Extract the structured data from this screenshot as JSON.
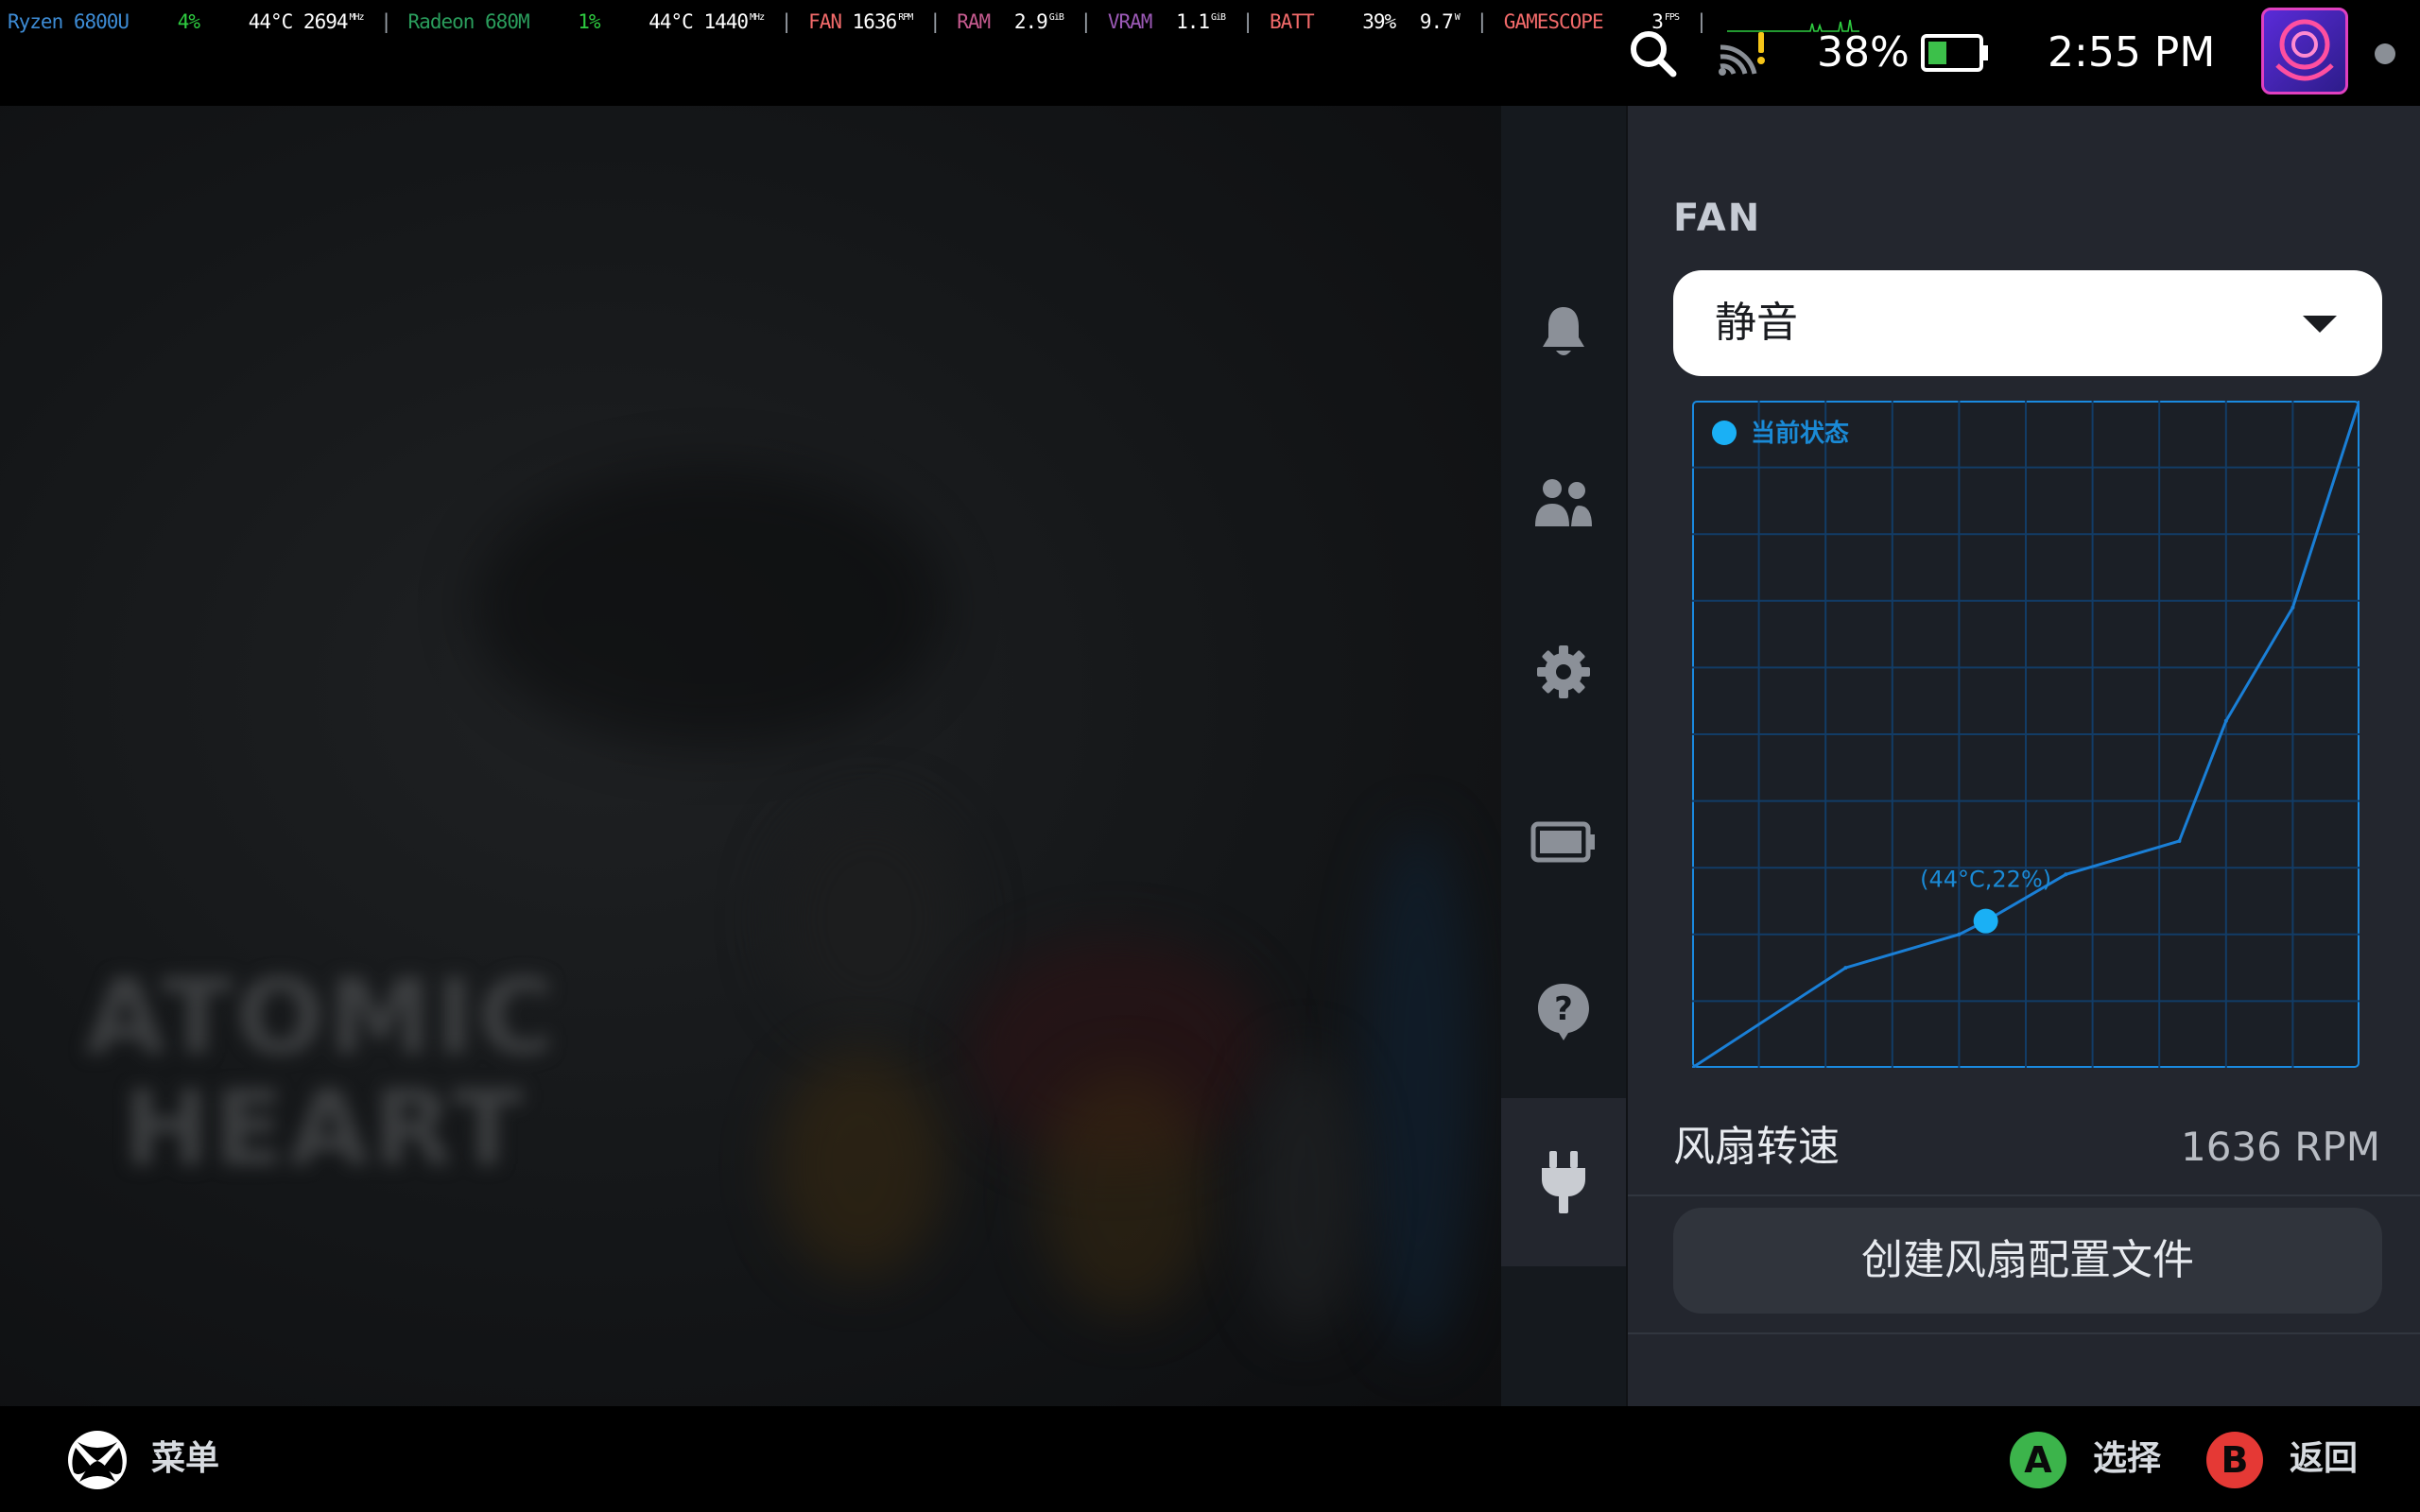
{
  "colors": {
    "cpu": "#3d8bd4",
    "green": "#2ecc40",
    "gpu": "#2a9d5c",
    "fan": "#f26a6a",
    "ram": "#c45a8e",
    "vram": "#9b59b6",
    "batt": "#f26a6a",
    "gamescope": "#f26a6a",
    "white": "#ffffff",
    "panel_bg": "#23262e",
    "chart_line": "#1a7fd6",
    "chart_point": "#1ab0f5",
    "btn_a": "#3cb44b",
    "btn_b": "#e53935"
  },
  "perf_overlay": {
    "cpu_name": "Ryzen 6800U",
    "cpu_load": "4%",
    "cpu_temp": "44°C",
    "cpu_clock": "2694",
    "cpu_clock_unit": "MHz",
    "gpu_name": "Radeon 680M",
    "gpu_load": "1%",
    "gpu_temp": "44°C",
    "gpu_clock": "1440",
    "gpu_clock_unit": "MHz",
    "fan_label": "FAN",
    "fan_value": "1636",
    "fan_unit": "RPM",
    "ram_label": "RAM",
    "ram_value": "2.9",
    "ram_unit": "GiB",
    "vram_label": "VRAM",
    "vram_value": "1.1",
    "vram_unit": "GiB",
    "batt_label": "BATT",
    "batt_percent": "39%",
    "batt_watts": "9.7",
    "batt_watts_unit": "W",
    "app_label": "GAMESCOPE",
    "fps_value": "3",
    "fps_unit": "FPS",
    "separator": "|"
  },
  "status_bar": {
    "battery_percent": "38%",
    "battery_level": 0.38,
    "time": "2:55 PM",
    "icons": [
      "search-icon",
      "wifi-icon",
      "battery-icon",
      "avatar",
      "notification-dot"
    ]
  },
  "game_bg": {
    "title_line1": "ATOMIC",
    "title_line2": "HEART"
  },
  "quick_access": {
    "items": [
      {
        "icon": "bell-icon",
        "active": false
      },
      {
        "icon": "friends-icon",
        "active": false
      },
      {
        "icon": "gear-icon",
        "active": false
      },
      {
        "icon": "battery-icon",
        "active": false
      },
      {
        "icon": "help-icon",
        "active": false
      },
      {
        "icon": "plug-icon",
        "active": true
      }
    ]
  },
  "panel": {
    "title": "FAN",
    "profile_value": "静音",
    "rpm_label": "风扇转速",
    "rpm_value": "1636 RPM",
    "create_button": "创建风扇配置文件"
  },
  "chart_data": {
    "type": "line",
    "legend": [
      "当前状态"
    ],
    "x": [
      0,
      23,
      40,
      44,
      56,
      73,
      80,
      90,
      100
    ],
    "y": [
      0,
      15,
      20,
      22,
      29,
      34,
      52,
      69,
      100
    ],
    "current_point": {
      "x": 44,
      "y": 22,
      "label": "(44°C,22%)"
    },
    "xlim": [
      0,
      100
    ],
    "ylim": [
      0,
      100
    ],
    "grid": true,
    "grid_divisions": 10,
    "legend_placement": "top-left"
  },
  "bottom_bar": {
    "menu_label": "菜单",
    "a_button": "A",
    "a_label": "选择",
    "b_button": "B",
    "b_label": "返回"
  }
}
